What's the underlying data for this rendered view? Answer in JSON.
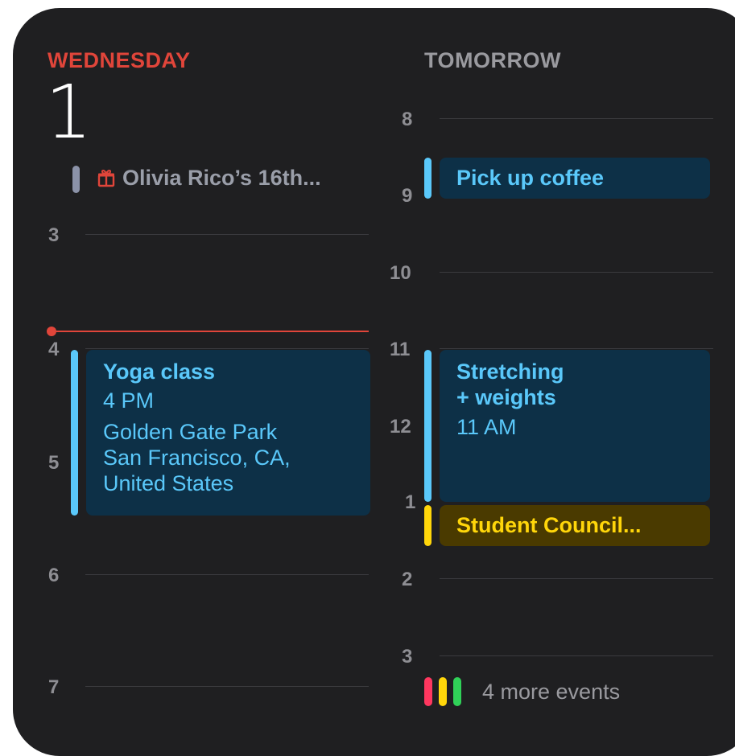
{
  "today": {
    "day_name": "WEDNESDAY",
    "date": "1",
    "all_day_event": "Olivia Rico’s 16th...",
    "hours": [
      "3",
      "4",
      "5",
      "6",
      "7"
    ]
  },
  "tomorrow": {
    "label": "TOMORROW",
    "hours": [
      "8",
      "9",
      "10",
      "11",
      "12",
      "1",
      "2",
      "3"
    ]
  },
  "events": [
    {
      "title": "Yoga class",
      "time": "4 PM",
      "location_line1": "Golden Gate Park",
      "location_line2": "San Francisco, CA,",
      "location_line3": "United States"
    },
    {
      "title": "Pick up coffee"
    },
    {
      "title_line1": "Stretching",
      "title_line2": "+ weights",
      "time": "11 AM"
    },
    {
      "title": "Student Council..."
    }
  ],
  "more_events": "4 more events",
  "colors": {
    "today_red": "#e0453a",
    "blue_event_text": "#5ac8fa",
    "blue_event_bg": "#0d3047",
    "yellow_event_text": "#ffd60a",
    "yellow_event_bg": "#4a3a00",
    "more_red": "#ff375f",
    "more_yellow": "#ffd60a",
    "more_green": "#30d158"
  },
  "icons": {
    "birthday": "gift-icon"
  }
}
